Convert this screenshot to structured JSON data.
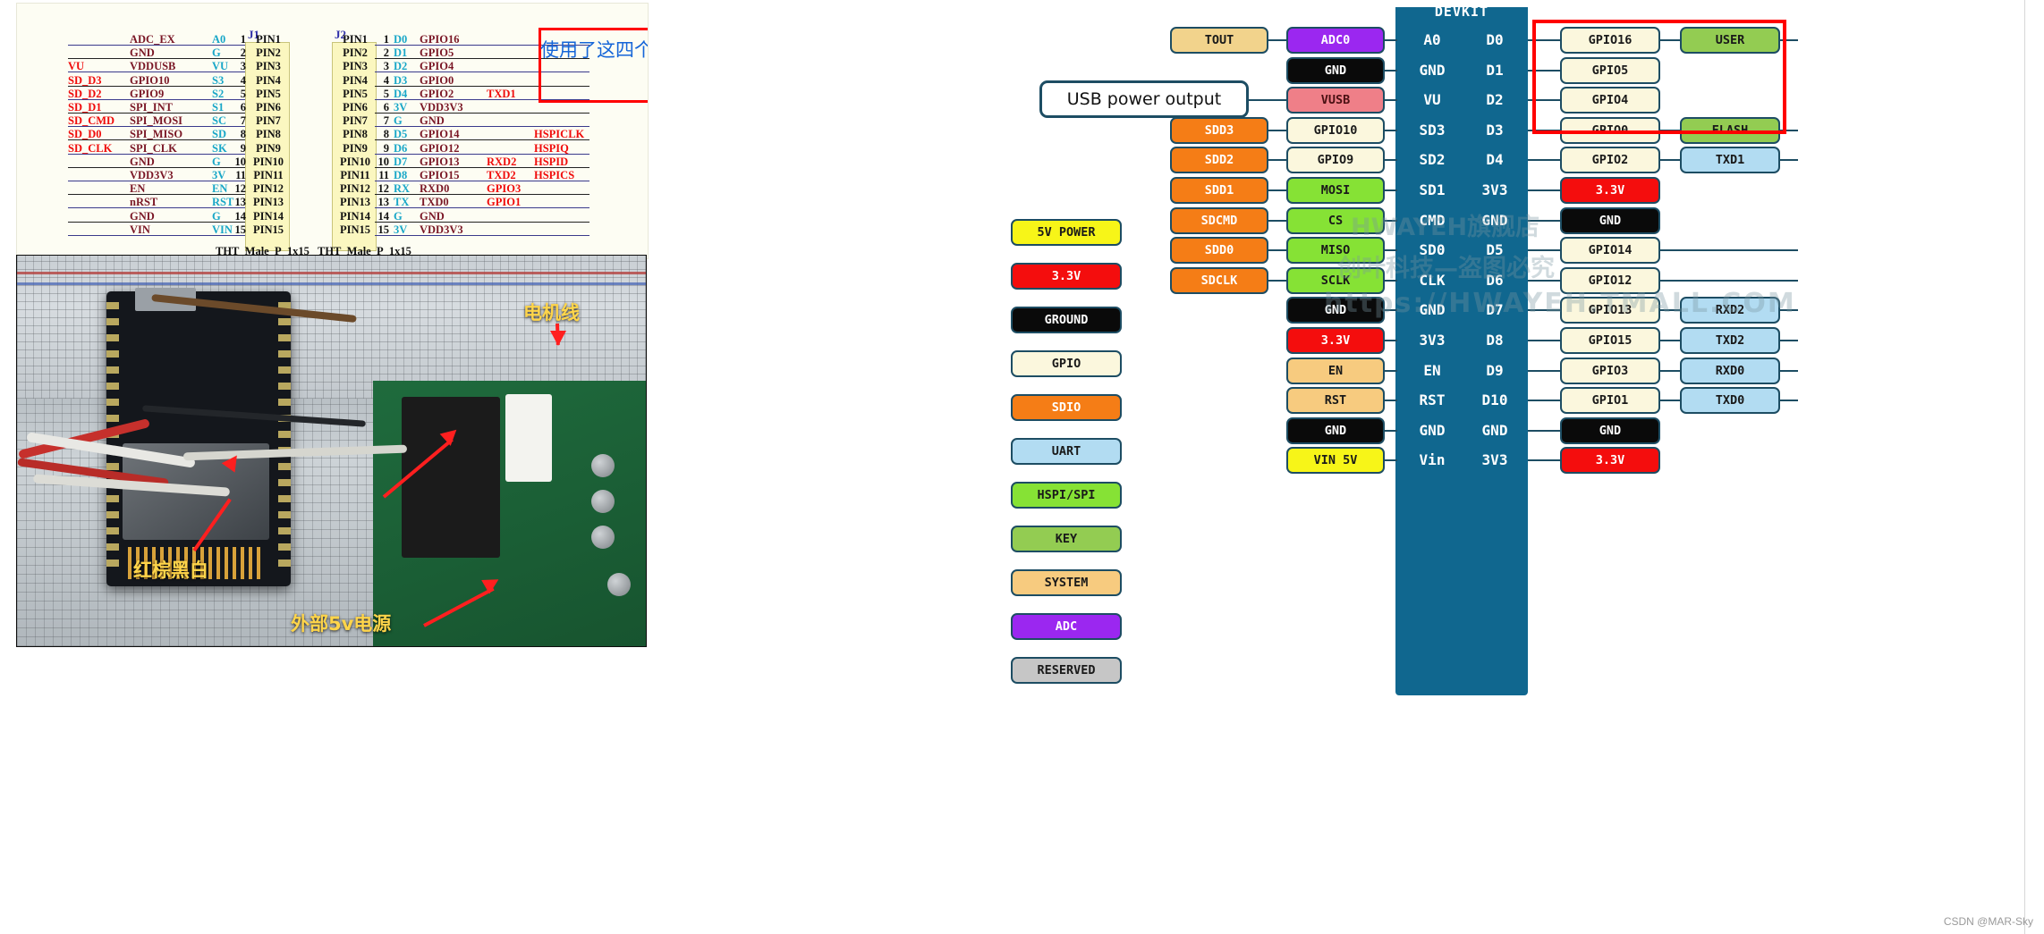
{
  "schematic": {
    "headers": {
      "j1": "J1",
      "j2": "J2"
    },
    "footers": {
      "j1": "THT_Male_P_1x15",
      "j2": "THT_Male_P_1x15"
    },
    "annotation_cn": "使用了这四个",
    "left_rows": [
      {
        "net": "",
        "func": "ADC_EX",
        "abbr": "A0",
        "num": "1"
      },
      {
        "net": "",
        "func": "GND",
        "abbr": "G",
        "num": "2"
      },
      {
        "net": "VU",
        "func": "VDDUSB",
        "abbr": "VU",
        "num": "3"
      },
      {
        "net": "SD_D3",
        "func": "GPIO10",
        "abbr": "S3",
        "num": "4"
      },
      {
        "net": "SD_D2",
        "func": "GPIO9",
        "abbr": "S2",
        "num": "5"
      },
      {
        "net": "SD_D1",
        "func": "SPI_INT",
        "abbr": "S1",
        "num": "6"
      },
      {
        "net": "SD_CMD",
        "func": "SPI_MOSI",
        "abbr": "SC",
        "num": "7"
      },
      {
        "net": "SD_D0",
        "func": "SPI_MISO",
        "abbr": "SD",
        "num": "8"
      },
      {
        "net": "SD_CLK",
        "func": "SPI_CLK",
        "abbr": "SK",
        "num": "9"
      },
      {
        "net": "",
        "func": "GND",
        "abbr": "G",
        "num": "10"
      },
      {
        "net": "",
        "func": "VDD3V3",
        "abbr": "3V",
        "num": "11"
      },
      {
        "net": "",
        "func": "EN",
        "abbr": "EN",
        "num": "12"
      },
      {
        "net": "",
        "func": "nRST",
        "abbr": "RST",
        "num": "13"
      },
      {
        "net": "",
        "func": "GND",
        "abbr": "G",
        "num": "14"
      },
      {
        "net": "",
        "func": "VIN",
        "abbr": "VIN",
        "num": "15"
      }
    ],
    "pin_names": [
      "PIN1",
      "PIN2",
      "PIN3",
      "PIN4",
      "PIN5",
      "PIN6",
      "PIN7",
      "PIN8",
      "PIN9",
      "PIN10",
      "PIN11",
      "PIN12",
      "PIN13",
      "PIN14",
      "PIN15"
    ],
    "right_rows": [
      {
        "num": "1",
        "abbr": "D0",
        "func": "GPIO16",
        "alt1": "",
        "alt2": ""
      },
      {
        "num": "2",
        "abbr": "D1",
        "func": "GPIO5",
        "alt1": "",
        "alt2": ""
      },
      {
        "num": "3",
        "abbr": "D2",
        "func": "GPIO4",
        "alt1": "",
        "alt2": ""
      },
      {
        "num": "4",
        "abbr": "D3",
        "func": "GPIO0",
        "alt1": "",
        "alt2": ""
      },
      {
        "num": "5",
        "abbr": "D4",
        "func": "GPIO2",
        "alt1": "TXD1",
        "alt2": ""
      },
      {
        "num": "6",
        "abbr": "3V",
        "func": "VDD3V3",
        "alt1": "",
        "alt2": ""
      },
      {
        "num": "7",
        "abbr": "G",
        "func": "GND",
        "alt1": "",
        "alt2": ""
      },
      {
        "num": "8",
        "abbr": "D5",
        "func": "GPIO14",
        "alt1": "",
        "alt2": "HSPICLK"
      },
      {
        "num": "9",
        "abbr": "D6",
        "func": "GPIO12",
        "alt1": "",
        "alt2": "HSPIQ"
      },
      {
        "num": "10",
        "abbr": "D7",
        "func": "GPIO13",
        "alt1": "RXD2",
        "alt2": "HSPID"
      },
      {
        "num": "11",
        "abbr": "D8",
        "func": "GPIO15",
        "alt1": "TXD2",
        "alt2": "HSPICS"
      },
      {
        "num": "12",
        "abbr": "RX",
        "func": "RXD0",
        "alt1": "GPIO3",
        "alt2": ""
      },
      {
        "num": "13",
        "abbr": "TX",
        "func": "TXD0",
        "alt1": "GPIO1",
        "alt2": ""
      },
      {
        "num": "14",
        "abbr": "G",
        "func": "GND",
        "alt1": "",
        "alt2": ""
      },
      {
        "num": "15",
        "abbr": "3V",
        "func": "VDD3V3",
        "alt1": "",
        "alt2": ""
      }
    ]
  },
  "photo": {
    "annotations": [
      {
        "text": "电机线",
        "name": "motor-wire-annotation"
      },
      {
        "text": "红棕黑白",
        "name": "wire-colors-annotation"
      },
      {
        "text": "外部5v电源",
        "name": "external-5v-supply-annotation"
      }
    ]
  },
  "devkit": {
    "title": "DEVKIT",
    "usb_note": "USB power output",
    "watermarks": [
      "HWAYEH旗舰店",
      "创叶科技—盗图必究",
      "https://HWAYEH.TMALL.COM"
    ],
    "legend": [
      {
        "label": "5V POWER",
        "bg": "#f7f518",
        "fg": "#1a1a1a"
      },
      {
        "label": "3.3V",
        "bg": "#f40d0d",
        "fg": "#ffffff"
      },
      {
        "label": "GROUND",
        "bg": "#0a0a0a",
        "fg": "#ffffff"
      },
      {
        "label": "GPIO",
        "bg": "#fbf7dd",
        "fg": "#1a1a1a"
      },
      {
        "label": "SDIO",
        "bg": "#f57d16",
        "fg": "#ffffff"
      },
      {
        "label": "UART",
        "bg": "#b2dcf2",
        "fg": "#1a1a1a"
      },
      {
        "label": "HSPI/SPI",
        "bg": "#86e235",
        "fg": "#1a1a1a"
      },
      {
        "label": "KEY",
        "bg": "#93cc52",
        "fg": "#1a1a1a"
      },
      {
        "label": "SYSTEM",
        "bg": "#f7cb7f",
        "fg": "#1a1a1a"
      },
      {
        "label": "ADC",
        "bg": "#9b27f0",
        "fg": "#ffffff"
      },
      {
        "label": "RESERVED",
        "bg": "#c6c6c6",
        "fg": "#1a1a1a"
      }
    ],
    "left_side": [
      {
        "pin": "A0",
        "c1": {
          "label": "TOUT",
          "bg": "#f2d38c",
          "fg": "#1a1a1a"
        },
        "c2": {
          "label": "ADC0",
          "bg": "#9b27f0",
          "fg": "#ffffff"
        }
      },
      {
        "pin": "GND",
        "c1": null,
        "c2": {
          "label": "GND",
          "bg": "#0a0a0a",
          "fg": "#ffffff"
        }
      },
      {
        "pin": "VU",
        "c1": null,
        "c2": {
          "label": "VUSB",
          "bg": "#ef7f88",
          "fg": "#4a1013"
        }
      },
      {
        "pin": "SD3",
        "c1": {
          "label": "SDD3",
          "bg": "#f57d16",
          "fg": "#ffffff"
        },
        "c2": {
          "label": "GPIO10",
          "bg": "#fbf7dd",
          "fg": "#1a1a1a"
        }
      },
      {
        "pin": "SD2",
        "c1": {
          "label": "SDD2",
          "bg": "#f57d16",
          "fg": "#ffffff"
        },
        "c2": {
          "label": "GPIO9",
          "bg": "#fbf7dd",
          "fg": "#1a1a1a"
        }
      },
      {
        "pin": "SD1",
        "c1": {
          "label": "SDD1",
          "bg": "#f57d16",
          "fg": "#ffffff"
        },
        "c2": {
          "label": "MOSI",
          "bg": "#86e235",
          "fg": "#1a1a1a"
        }
      },
      {
        "pin": "CMD",
        "c1": {
          "label": "SDCMD",
          "bg": "#f57d16",
          "fg": "#ffffff"
        },
        "c2": {
          "label": "CS",
          "bg": "#86e235",
          "fg": "#1a1a1a"
        }
      },
      {
        "pin": "SD0",
        "c1": {
          "label": "SDD0",
          "bg": "#f57d16",
          "fg": "#ffffff"
        },
        "c2": {
          "label": "MISO",
          "bg": "#86e235",
          "fg": "#1a1a1a"
        }
      },
      {
        "pin": "CLK",
        "c1": {
          "label": "SDCLK",
          "bg": "#f57d16",
          "fg": "#ffffff"
        },
        "c2": {
          "label": "SCLK",
          "bg": "#86e235",
          "fg": "#1a1a1a"
        }
      },
      {
        "pin": "GND",
        "c1": null,
        "c2": {
          "label": "GND",
          "bg": "#0a0a0a",
          "fg": "#ffffff"
        }
      },
      {
        "pin": "3V3",
        "c1": null,
        "c2": {
          "label": "3.3V",
          "bg": "#f40d0d",
          "fg": "#ffffff"
        }
      },
      {
        "pin": "EN",
        "c1": null,
        "c2": {
          "label": "EN",
          "bg": "#f7cb7f",
          "fg": "#1a1a1a"
        }
      },
      {
        "pin": "RST",
        "c1": null,
        "c2": {
          "label": "RST",
          "bg": "#f7cb7f",
          "fg": "#1a1a1a"
        }
      },
      {
        "pin": "GND",
        "c1": null,
        "c2": {
          "label": "GND",
          "bg": "#0a0a0a",
          "fg": "#ffffff"
        }
      },
      {
        "pin": "Vin",
        "c1": null,
        "c2": {
          "label": "VIN 5V",
          "bg": "#f7f518",
          "fg": "#1a1a1a"
        }
      }
    ],
    "right_side": [
      {
        "pin": "D0",
        "c1": {
          "label": "GPIO16",
          "bg": "#fbf7dd",
          "fg": "#1a1a1a"
        },
        "c2": {
          "label": "USER",
          "bg": "#93cc52",
          "fg": "#1a1a1a"
        }
      },
      {
        "pin": "D1",
        "c1": {
          "label": "GPIO5",
          "bg": "#fbf7dd",
          "fg": "#1a1a1a"
        },
        "c2": null
      },
      {
        "pin": "D2",
        "c1": {
          "label": "GPIO4",
          "bg": "#fbf7dd",
          "fg": "#1a1a1a"
        },
        "c2": null
      },
      {
        "pin": "D3",
        "c1": {
          "label": "GPIO0",
          "bg": "#fbf7dd",
          "fg": "#1a1a1a"
        },
        "c2": {
          "label": "FLASH",
          "bg": "#93cc52",
          "fg": "#1a1a1a"
        }
      },
      {
        "pin": "D4",
        "c1": {
          "label": "GPIO2",
          "bg": "#fbf7dd",
          "fg": "#1a1a1a"
        },
        "c2": {
          "label": "TXD1",
          "bg": "#b2dcf2",
          "fg": "#1a1a1a"
        }
      },
      {
        "pin": "3V3",
        "c1": {
          "label": "3.3V",
          "bg": "#f40d0d",
          "fg": "#ffffff"
        },
        "c2": null
      },
      {
        "pin": "GND",
        "c1": {
          "label": "GND",
          "bg": "#0a0a0a",
          "fg": "#ffffff"
        },
        "c2": null
      },
      {
        "pin": "D5",
        "c1": {
          "label": "GPIO14",
          "bg": "#fbf7dd",
          "fg": "#1a1a1a"
        },
        "c2": null
      },
      {
        "pin": "D6",
        "c1": {
          "label": "GPIO12",
          "bg": "#fbf7dd",
          "fg": "#1a1a1a"
        },
        "c2": null
      },
      {
        "pin": "D7",
        "c1": {
          "label": "GPIO13",
          "bg": "#fbf7dd",
          "fg": "#1a1a1a"
        },
        "c2": {
          "label": "RXD2",
          "bg": "#b2dcf2",
          "fg": "#1a1a1a"
        }
      },
      {
        "pin": "D8",
        "c1": {
          "label": "GPIO15",
          "bg": "#fbf7dd",
          "fg": "#1a1a1a"
        },
        "c2": {
          "label": "TXD2",
          "bg": "#b2dcf2",
          "fg": "#1a1a1a"
        }
      },
      {
        "pin": "D9",
        "c1": {
          "label": "GPIO3",
          "bg": "#fbf7dd",
          "fg": "#1a1a1a"
        },
        "c2": {
          "label": "RXD0",
          "bg": "#b2dcf2",
          "fg": "#1a1a1a"
        }
      },
      {
        "pin": "D10",
        "c1": {
          "label": "GPIO1",
          "bg": "#fbf7dd",
          "fg": "#1a1a1a"
        },
        "c2": {
          "label": "TXD0",
          "bg": "#b2dcf2",
          "fg": "#1a1a1a"
        }
      },
      {
        "pin": "GND",
        "c1": {
          "label": "GND",
          "bg": "#0a0a0a",
          "fg": "#ffffff"
        },
        "c2": null
      },
      {
        "pin": "3V3",
        "c1": {
          "label": "3.3V",
          "bg": "#f40d0d",
          "fg": "#ffffff"
        },
        "c2": null
      }
    ]
  },
  "footer": {
    "credit": "CSDN @MAR-Sky"
  }
}
